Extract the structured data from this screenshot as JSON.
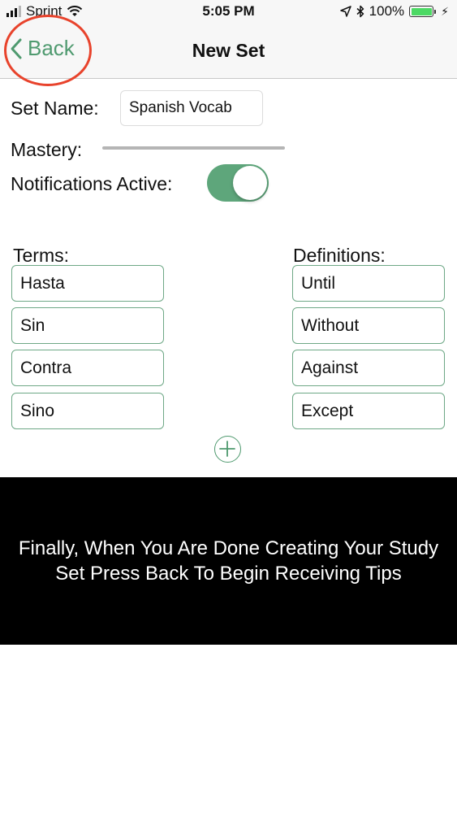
{
  "status_bar": {
    "carrier": "Sprint",
    "time": "5:05 PM",
    "battery_percent": "100%",
    "battery_level": 1.0,
    "battery_color": "#4cd964",
    "icons": [
      "signal-icon",
      "wifi-icon",
      "location-arrow-icon",
      "bluetooth-icon",
      "battery-icon",
      "charging-bolt-icon"
    ]
  },
  "nav": {
    "back_label": "Back",
    "title": "New Set",
    "accent_color": "#4f9a6f",
    "highlight_color": "#e8432c"
  },
  "form": {
    "set_name_label": "Set Name:",
    "set_name_value": "Spanish Vocab",
    "mastery_label": "Mastery:",
    "mastery_level": 0,
    "notifications_label": "Notifications Active:",
    "notifications_on": true,
    "toggle_color": "#5ea67b"
  },
  "cards": {
    "terms_header": "Terms:",
    "definitions_header": "Definitions:",
    "rows": [
      {
        "term": "Hasta",
        "definition": "Until"
      },
      {
        "term": "Sin",
        "definition": "Without"
      },
      {
        "term": "Contra",
        "definition": "Against"
      },
      {
        "term": "Sino",
        "definition": "Except"
      }
    ],
    "add_icon": "plus-circle-icon"
  },
  "caption": {
    "text": "Finally, When You Are Done Creating Your Study Set Press Back To Begin Receiving Tips"
  }
}
